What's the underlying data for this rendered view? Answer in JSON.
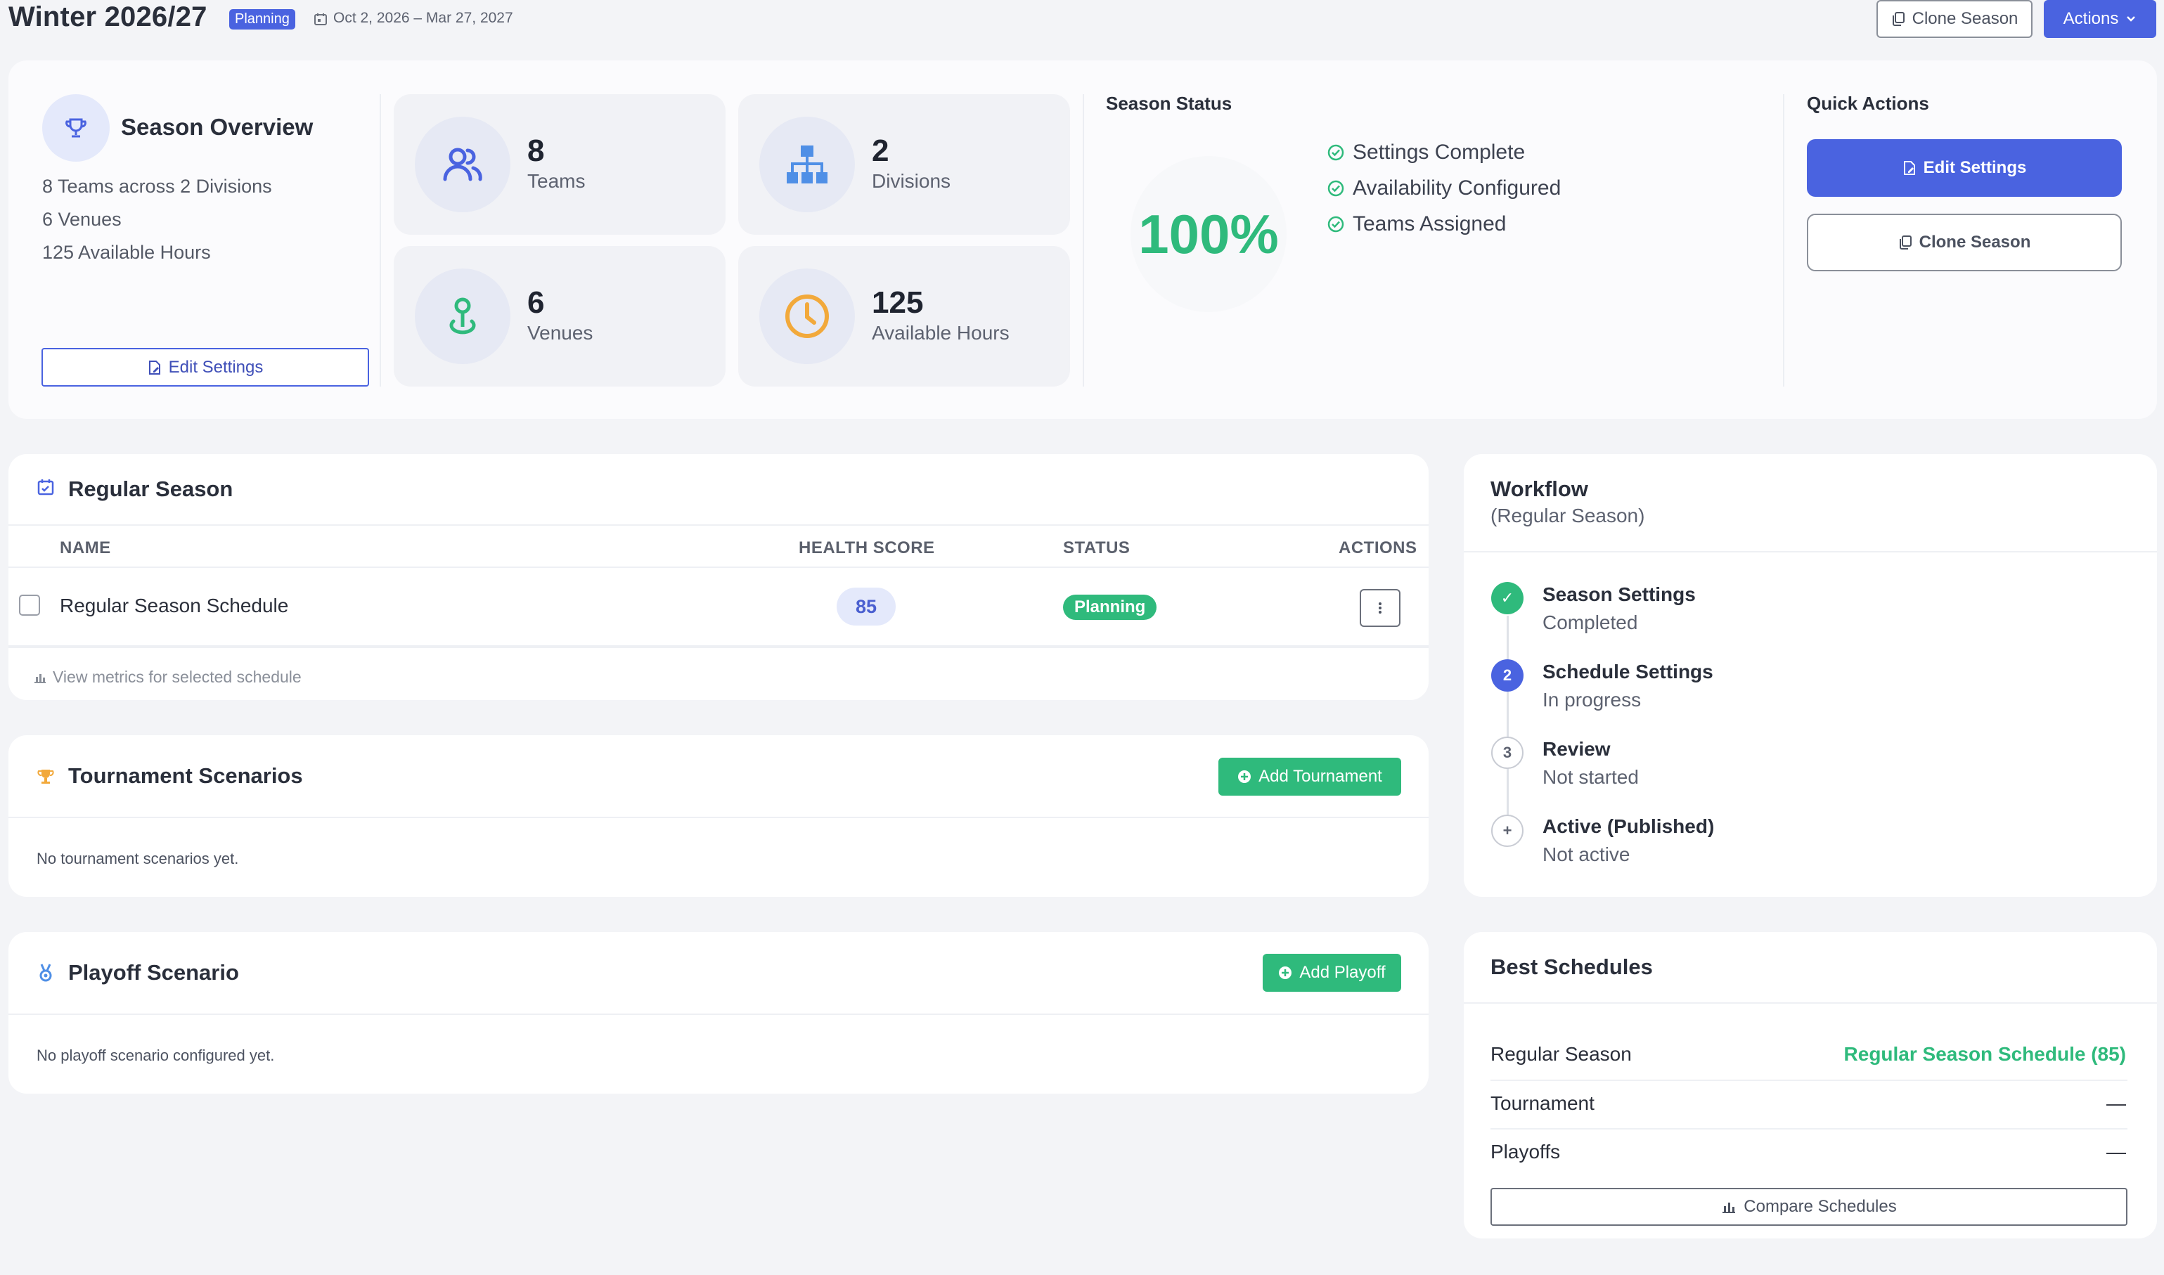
{
  "header": {
    "title": "Winter 2026/27",
    "status_badge": "Planning",
    "date_range": "Oct 2, 2026 – Mar 27, 2027",
    "clone_label": "Clone Season",
    "actions_label": "Actions"
  },
  "overview": {
    "title": "Season Overview",
    "lines": [
      "8 Teams across 2 Divisions",
      "6 Venues",
      "125 Available Hours"
    ],
    "edit_label": "Edit Settings",
    "stats": [
      {
        "value": "8",
        "label": "Teams",
        "icon": "users-icon",
        "color": "#4a63e0"
      },
      {
        "value": "2",
        "label": "Divisions",
        "icon": "org-chart-icon",
        "color": "#4f8fe6"
      },
      {
        "value": "6",
        "label": "Venues",
        "icon": "location-pin-icon",
        "color": "#2fba7c"
      },
      {
        "value": "125",
        "label": "Available Hours",
        "icon": "clock-icon",
        "color": "#f2a93b"
      }
    ]
  },
  "season_status": {
    "title": "Season Status",
    "percent": "100%",
    "checks": [
      "Settings Complete",
      "Availability Configured",
      "Teams Assigned"
    ]
  },
  "quick_actions": {
    "title": "Quick Actions",
    "edit_label": "Edit Settings",
    "clone_label": "Clone Season"
  },
  "regular_season": {
    "title": "Regular Season",
    "columns": [
      "NAME",
      "HEALTH SCORE",
      "STATUS",
      "ACTIONS"
    ],
    "rows": [
      {
        "name": "Regular Season Schedule",
        "health": "85",
        "status": "Planning"
      }
    ],
    "metrics_link": "View metrics for selected schedule"
  },
  "tournament": {
    "title": "Tournament Scenarios",
    "add_label": "Add Tournament",
    "empty": "No tournament scenarios yet."
  },
  "playoff": {
    "title": "Playoff Scenario",
    "add_label": "Add Playoff",
    "empty": "No playoff scenario configured yet."
  },
  "workflow": {
    "title": "Workflow",
    "subtitle": "(Regular Season)",
    "steps": [
      {
        "marker": "✓",
        "title": "Season Settings",
        "status": "Completed",
        "state": "done"
      },
      {
        "marker": "2",
        "title": "Schedule Settings",
        "status": "In progress",
        "state": "active"
      },
      {
        "marker": "3",
        "title": "Review",
        "status": "Not started",
        "state": "pending"
      },
      {
        "marker": "+",
        "title": "Active (Published)",
        "status": "Not active",
        "state": "pending"
      }
    ]
  },
  "best_schedules": {
    "title": "Best Schedules",
    "rows": [
      {
        "label": "Regular Season",
        "value": "Regular Season Schedule (85)"
      },
      {
        "label": "Tournament",
        "value": "—"
      },
      {
        "label": "Playoffs",
        "value": "—"
      }
    ],
    "compare_label": "Compare Schedules"
  },
  "colors": {
    "primary": "#4a63e0",
    "success": "#2fba7c",
    "warning": "#f2a93b",
    "background": "#f3f4f7"
  }
}
